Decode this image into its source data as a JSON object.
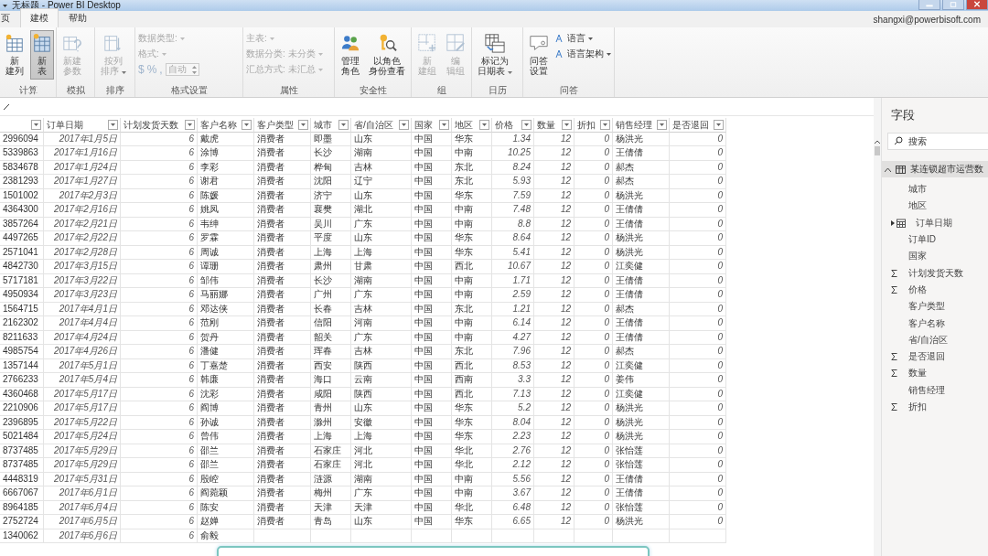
{
  "window": {
    "title": "无标题 - Power BI Desktop"
  },
  "menu": {
    "tabs": [
      {
        "label": "页",
        "selected": false
      },
      {
        "label": "建模",
        "selected": true
      },
      {
        "label": "帮助",
        "selected": false
      }
    ],
    "account": "shangxi@powerbisoft.com"
  },
  "ribbon": {
    "groups": [
      {
        "label": "计算",
        "items": [
          {
            "kind": "large",
            "lines": [
              "新",
              "建列"
            ],
            "disabled": false,
            "selected": false
          },
          {
            "kind": "large",
            "lines": [
              "新",
              "表"
            ],
            "disabled": false,
            "selected": true
          }
        ]
      },
      {
        "label": "模拟",
        "items": [
          {
            "kind": "large",
            "lines": [
              "新建",
              "参数"
            ],
            "disabled": true,
            "selected": false
          }
        ]
      },
      {
        "label": "排序",
        "items": [
          {
            "kind": "large",
            "lines": [
              "按列",
              "排序"
            ],
            "disabled": true,
            "selected": false,
            "caret": true
          }
        ]
      },
      {
        "label": "格式设置",
        "items": [
          {
            "kind": "dropdown",
            "label": "数据类型:",
            "disabled": true
          },
          {
            "kind": "dropdown",
            "label": "格式:",
            "disabled": true
          },
          {
            "kind": "format",
            "symbols": [
              "$",
              "%",
              ","
            ],
            "value": "自动",
            "disabled": true
          }
        ]
      },
      {
        "label": "属性",
        "items": [
          {
            "kind": "dropdown",
            "label": "主表:",
            "disabled": true
          },
          {
            "kind": "dropdown",
            "label": "数据分类: 未分类",
            "disabled": true
          },
          {
            "kind": "dropdown",
            "label": "汇总方式: 未汇总",
            "disabled": true
          }
        ]
      },
      {
        "label": "安全性",
        "items": [
          {
            "kind": "large",
            "lines": [
              "管理",
              "角色"
            ],
            "disabled": false,
            "selected": false
          },
          {
            "kind": "large",
            "lines": [
              "以角色",
              "身份查看"
            ],
            "disabled": false,
            "selected": false
          }
        ]
      },
      {
        "label": "组",
        "items": [
          {
            "kind": "large",
            "lines": [
              "新",
              "建组"
            ],
            "disabled": true,
            "selected": false
          },
          {
            "kind": "large",
            "lines": [
              "编",
              "辑组"
            ],
            "disabled": true,
            "selected": false
          }
        ]
      },
      {
        "label": "日历",
        "items": [
          {
            "kind": "large",
            "lines": [
              "标记为",
              "日期表"
            ],
            "disabled": false,
            "selected": false,
            "caret": true
          }
        ]
      },
      {
        "label": "问答",
        "items": [
          {
            "kind": "large",
            "lines": [
              "问答",
              "设置"
            ],
            "disabled": false,
            "selected": false
          },
          {
            "kind": "menu",
            "label": "语言",
            "disabled": false
          },
          {
            "kind": "menu",
            "label": "语言架构",
            "disabled": false
          }
        ]
      }
    ]
  },
  "table": {
    "columns": [
      {
        "kind": "text"
      },
      {
        "label": "订单日期",
        "kind": "number"
      },
      {
        "label": "计划发货天数",
        "kind": "number"
      },
      {
        "label": "客户名称",
        "kind": "text"
      },
      {
        "label": "客户类型",
        "kind": "text"
      },
      {
        "label": "城市",
        "kind": "text"
      },
      {
        "label": "省/自治区",
        "kind": "text"
      },
      {
        "label": "国家",
        "kind": "text"
      },
      {
        "label": "地区",
        "kind": "text"
      },
      {
        "label": "价格",
        "kind": "number"
      },
      {
        "label": "数量",
        "kind": "number"
      },
      {
        "label": "折扣",
        "kind": "number"
      },
      {
        "label": "销售经理",
        "kind": "text"
      },
      {
        "label": "是否退回",
        "kind": "number"
      }
    ],
    "rows": [
      [
        "2996094",
        "2017年1月5日",
        "6",
        "戴虎",
        "消费者",
        "即墨",
        "山东",
        "中国",
        "华东",
        "1.34",
        "12",
        "0",
        "杨洪光",
        "0"
      ],
      [
        "5339863",
        "2017年1月16日",
        "6",
        "涂博",
        "消费者",
        "长沙",
        "湖南",
        "中国",
        "中南",
        "10.25",
        "12",
        "0",
        "王倩倩",
        "0"
      ],
      [
        "5834678",
        "2017年1月24日",
        "6",
        "李彩",
        "消费者",
        "桦甸",
        "吉林",
        "中国",
        "东北",
        "8.24",
        "12",
        "0",
        "郝杰",
        "0"
      ],
      [
        "2381293",
        "2017年1月27日",
        "6",
        "谢君",
        "消费者",
        "沈阳",
        "辽宁",
        "中国",
        "东北",
        "5.93",
        "12",
        "0",
        "郝杰",
        "0"
      ],
      [
        "1501002",
        "2017年2月3日",
        "6",
        "陈媛",
        "消费者",
        "济宁",
        "山东",
        "中国",
        "华东",
        "7.59",
        "12",
        "0",
        "杨洪光",
        "0"
      ],
      [
        "4364300",
        "2017年2月16日",
        "6",
        "姚凤",
        "消费者",
        "襄樊",
        "湖北",
        "中国",
        "中南",
        "7.48",
        "12",
        "0",
        "王倩倩",
        "0"
      ],
      [
        "3857264",
        "2017年2月21日",
        "6",
        "韦绅",
        "消费者",
        "吴川",
        "广东",
        "中国",
        "中南",
        "8.8",
        "12",
        "0",
        "王倩倩",
        "0"
      ],
      [
        "4497265",
        "2017年2月22日",
        "6",
        "罗霖",
        "消费者",
        "平度",
        "山东",
        "中国",
        "华东",
        "8.64",
        "12",
        "0",
        "杨洪光",
        "0"
      ],
      [
        "2571041",
        "2017年2月28日",
        "6",
        "周诚",
        "消费者",
        "上海",
        "上海",
        "中国",
        "华东",
        "5.41",
        "12",
        "0",
        "杨洪光",
        "0"
      ],
      [
        "4842730",
        "2017年3月15日",
        "6",
        "谭珊",
        "消费者",
        "肃州",
        "甘肃",
        "中国",
        "西北",
        "10.67",
        "12",
        "0",
        "江奕健",
        "0"
      ],
      [
        "5717181",
        "2017年3月22日",
        "6",
        "邹伟",
        "消费者",
        "长沙",
        "湖南",
        "中国",
        "中南",
        "1.71",
        "12",
        "0",
        "王倩倩",
        "0"
      ],
      [
        "4950934",
        "2017年3月23日",
        "6",
        "马丽娜",
        "消费者",
        "广州",
        "广东",
        "中国",
        "中南",
        "2.59",
        "12",
        "0",
        "王倩倩",
        "0"
      ],
      [
        "1564715",
        "2017年4月1日",
        "6",
        "邓达侠",
        "消费者",
        "长春",
        "吉林",
        "中国",
        "东北",
        "1.21",
        "12",
        "0",
        "郝杰",
        "0"
      ],
      [
        "2162302",
        "2017年4月4日",
        "6",
        "范刚",
        "消费者",
        "信阳",
        "河南",
        "中国",
        "中南",
        "6.14",
        "12",
        "0",
        "王倩倩",
        "0"
      ],
      [
        "8211633",
        "2017年4月24日",
        "6",
        "贺丹",
        "消费者",
        "韶关",
        "广东",
        "中国",
        "中南",
        "4.27",
        "12",
        "0",
        "王倩倩",
        "0"
      ],
      [
        "4985754",
        "2017年4月26日",
        "6",
        "潘健",
        "消费者",
        "珲春",
        "吉林",
        "中国",
        "东北",
        "7.96",
        "12",
        "0",
        "郝杰",
        "0"
      ],
      [
        "1357144",
        "2017年5月1日",
        "6",
        "丁嘉楚",
        "消费者",
        "西安",
        "陕西",
        "中国",
        "西北",
        "8.53",
        "12",
        "0",
        "江奕健",
        "0"
      ],
      [
        "2766233",
        "2017年5月4日",
        "6",
        "韩廉",
        "消费者",
        "海口",
        "云南",
        "中国",
        "西南",
        "3.3",
        "12",
        "0",
        "姜伟",
        "0"
      ],
      [
        "4360468",
        "2017年5月17日",
        "6",
        "沈彩",
        "消费者",
        "咸阳",
        "陕西",
        "中国",
        "西北",
        "7.13",
        "12",
        "0",
        "江奕健",
        "0"
      ],
      [
        "2210906",
        "2017年5月17日",
        "6",
        "阎博",
        "消费者",
        "青州",
        "山东",
        "中国",
        "华东",
        "5.2",
        "12",
        "0",
        "杨洪光",
        "0"
      ],
      [
        "2396895",
        "2017年5月22日",
        "6",
        "孙诚",
        "消费者",
        "滁州",
        "安徽",
        "中国",
        "华东",
        "8.04",
        "12",
        "0",
        "杨洪光",
        "0"
      ],
      [
        "5021484",
        "2017年5月24日",
        "6",
        "曾伟",
        "消费者",
        "上海",
        "上海",
        "中国",
        "华东",
        "2.23",
        "12",
        "0",
        "杨洪光",
        "0"
      ],
      [
        "8737485",
        "2017年5月29日",
        "6",
        "邵兰",
        "消费者",
        "石家庄",
        "河北",
        "中国",
        "华北",
        "2.76",
        "12",
        "0",
        "张怡莲",
        "0"
      ],
      [
        "8737485",
        "2017年5月29日",
        "6",
        "邵兰",
        "消费者",
        "石家庄",
        "河北",
        "中国",
        "华北",
        "2.12",
        "12",
        "0",
        "张怡莲",
        "0"
      ],
      [
        "4448319",
        "2017年5月31日",
        "6",
        "殷崆",
        "消费者",
        "涟源",
        "湖南",
        "中国",
        "中南",
        "5.56",
        "12",
        "0",
        "王倩倩",
        "0"
      ],
      [
        "6667067",
        "2017年6月1日",
        "6",
        "阎菀颖",
        "消费者",
        "梅州",
        "广东",
        "中国",
        "中南",
        "3.67",
        "12",
        "0",
        "王倩倩",
        "0"
      ],
      [
        "8964185",
        "2017年6月4日",
        "6",
        "陈安",
        "消费者",
        "天津",
        "天津",
        "中国",
        "华北",
        "6.48",
        "12",
        "0",
        "张怡莲",
        "0"
      ],
      [
        "2752724",
        "2017年6月5日",
        "6",
        "赵婵",
        "消费者",
        "青岛",
        "山东",
        "中国",
        "华东",
        "6.65",
        "12",
        "0",
        "杨洪光",
        "0"
      ],
      [
        "1340062",
        "2017年6月6日",
        "6",
        "俞毅"
      ]
    ]
  },
  "fields": {
    "title": "字段",
    "search": {
      "placeholder": "搜索"
    },
    "table": {
      "name": "某连锁超市运营数",
      "expanded": true
    },
    "items": [
      {
        "label": "城市",
        "kind": "text"
      },
      {
        "label": "地区",
        "kind": "text"
      },
      {
        "label": "订单日期",
        "kind": "date"
      },
      {
        "label": "订单ID",
        "kind": "text"
      },
      {
        "label": "国家",
        "kind": "text"
      },
      {
        "label": "计划发货天数",
        "kind": "sum"
      },
      {
        "label": "价格",
        "kind": "sum"
      },
      {
        "label": "客户类型",
        "kind": "text"
      },
      {
        "label": "客户名称",
        "kind": "text"
      },
      {
        "label": "省/自治区",
        "kind": "text"
      },
      {
        "label": "是否退回",
        "kind": "sum"
      },
      {
        "label": "数量",
        "kind": "sum"
      },
      {
        "label": "销售经理",
        "kind": "text"
      },
      {
        "label": "折扣",
        "kind": "sum"
      }
    ]
  }
}
